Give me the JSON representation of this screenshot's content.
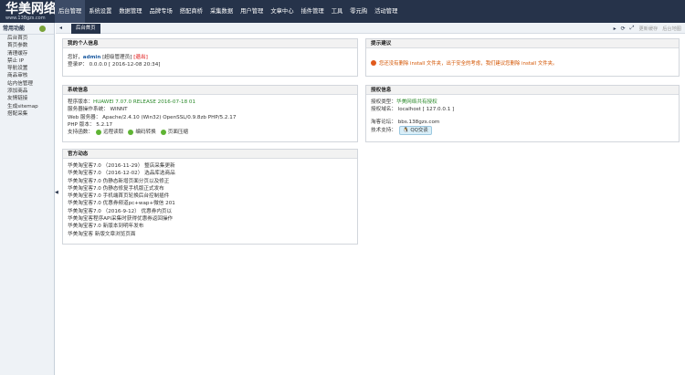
{
  "brand": {
    "title": "华美网络",
    "url": "www.138gzs.com"
  },
  "nav": [
    "后台管理",
    "系统设置",
    "数据管理",
    "品牌专场",
    "搭配商桥",
    "采集数据",
    "用户管理",
    "文章中心",
    "插件管理",
    "工具",
    "零元购",
    "活动管理"
  ],
  "sidebar": {
    "title": "常用功能",
    "items": [
      "后台首页",
      "首页参数",
      "清理缓存",
      "禁止 IP",
      "导航设置",
      "商品审核",
      "站内信管理",
      "添加商品",
      "友情链接",
      "生成sitemap",
      "搭配采集"
    ]
  },
  "tabs": {
    "home": "后台首页"
  },
  "toolbar": {
    "clear_cache": "更新缓存",
    "map": "后台地图"
  },
  "personal": {
    "title": "我的个人信息",
    "hello": "您好，",
    "user": "admin",
    "role": "[超级管理员]",
    "logout": "[退出]",
    "login_ip": "登录IP： 0.0.0.0 [ 2016-12-08 20:34]"
  },
  "tips": {
    "title": "提示建议",
    "warning": "您还没有删除 install 文件夹，出于安全的考虑，我们建议您删除 install 文件夹。"
  },
  "system": {
    "title": "系统信息",
    "ver_label": "程序版本：",
    "ver_value": "HUAWEI 7.07.0 RELEASE 2016-07-18 01",
    "os": "服务器操作系统： WINNT",
    "web": "Web 服务器： Apache/2.4.10 (Win32) OpenSSL/0.9.8zb PHP/5.2.17",
    "php": "PHP 版本： 5.2.17",
    "support_label": "支持函数：",
    "funcs": [
      "远程读取",
      "编码转换",
      "页面压缩"
    ]
  },
  "license": {
    "title": "授权信息",
    "type_label": "授权类型：",
    "type_value": "华美网络共有授权",
    "domain": "授权域名： localhost [ 127.0.0.1 ]",
    "forum": "淘客论坛： bbs.138gzs.com",
    "support_label": "技术支持：",
    "qq": "QQ交谈"
  },
  "news": {
    "title": "官方动态",
    "items": [
      "华美淘宝客7.0 （2016-11-29） 整店采集更新",
      "华美淘宝客7.0 （2016-12-02） 选品库选商品",
      "华美淘宝客7.0 伪静态新增页面分页以及修正",
      "华美淘宝客7.0 伪静态修复手机版正式发布",
      "华美淘宝客7.0 手机端首页轮换后台控制插件",
      "华美淘宝客7.0 优惠券频道pc+wap+微信 201",
      "华美淘宝客7.0 （2016-9-12） 优惠券内页以",
      "华美淘宝客程序API采集时获得优惠券返回操作",
      "华美淘宝客7.0 新版本到明年发布",
      "华美淘宝客 新版文章浏览页面"
    ]
  }
}
